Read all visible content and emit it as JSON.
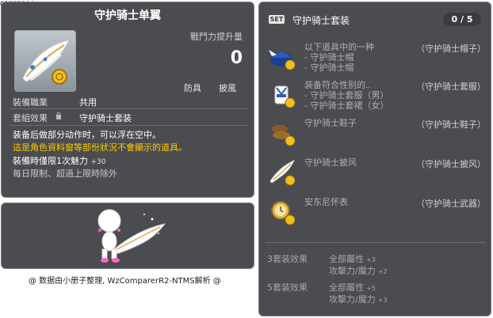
{
  "item_id": "01103114",
  "item": {
    "title": "守护骑士单翼",
    "power_label": "戰鬥力提升量",
    "power_value": "0",
    "tags": [
      "防具",
      "披風"
    ],
    "job_label": "裝備職業",
    "job_value": "共用",
    "set_label": "套組效果",
    "set_value": "守护骑士套装",
    "desc_lines": [
      {
        "text": "装备后做部分动作时，可以浮在空中。",
        "style": "white"
      },
      {
        "text": "這是角色資料窗等部份狀況不會顯示的道具。",
        "style": "yellow"
      },
      {
        "text": "裝備時僅限1次魅力",
        "num": "+30",
        "style": "white"
      },
      {
        "text": "每日限制、超過上限時除外",
        "style": "gray"
      }
    ]
  },
  "footer": "@ 数据由小册子整理, WzComparerR2-NTMS解析 @",
  "set": {
    "badge": "SET",
    "name": "守护骑士套装",
    "count": "0 / 5",
    "items": [
      {
        "icon": "hat-icon",
        "lines": [
          "以下道具中的一种",
          "- 守护骑士帽",
          "- 守护骑士帽"
        ],
        "slot": "（守护骑士帽子）"
      },
      {
        "icon": "suit-icon",
        "lines": [
          "装备符合性别的..",
          "- 守护骑士套服（男）",
          "- 守护骑士套裙（女）"
        ],
        "slot": "（守护骑士套服）"
      },
      {
        "icon": "shoes-icon",
        "lines": [
          "守护骑士鞋子"
        ],
        "slot": "（守护骑士鞋子）"
      },
      {
        "icon": "cape-icon",
        "lines": [
          "守护骑士披风"
        ],
        "slot": "（守护骑士披风）"
      },
      {
        "icon": "weapon-icon",
        "lines": [
          "安东尼怀表"
        ],
        "slot": "（守护骑士武器）"
      }
    ],
    "bonuses": [
      {
        "label": "3套装效果",
        "lines": [
          {
            "text": "全部屬性",
            "num": "+3"
          },
          {
            "text": "攻擊力/魔力",
            "num": "+2"
          }
        ]
      },
      {
        "label": "5套装效果",
        "lines": [
          {
            "text": "全部屬性",
            "num": "+5"
          },
          {
            "text": "攻擊力/魔力",
            "num": "+3"
          }
        ]
      }
    ]
  }
}
